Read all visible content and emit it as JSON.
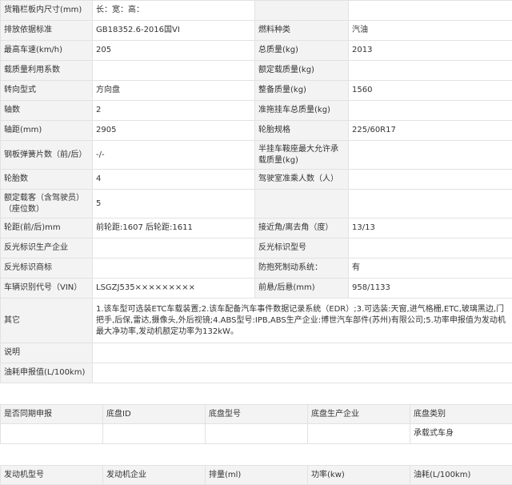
{
  "main_table": {
    "rows": [
      {
        "l1": "货箱栏板内尺寸(mm)",
        "v1": "长：宽：高：",
        "l2": "",
        "v2": ""
      },
      {
        "l1": "排放依据标准",
        "v1": "GB18352.6-2016国VI",
        "l2": "燃料种类",
        "v2": "汽油"
      },
      {
        "l1": "最高车速(km/h)",
        "v1": "205",
        "l2": "总质量(kg)",
        "v2": "2013"
      },
      {
        "l1": "载质量利用系数",
        "v1": "",
        "l2": "额定载质量(kg)",
        "v2": ""
      },
      {
        "l1": "转向型式",
        "v1": "方向盘",
        "l2": "整备质量(kg)",
        "v2": "1560"
      },
      {
        "l1": "轴数",
        "v1": "2",
        "l2": "准拖挂车总质量(kg)",
        "v2": ""
      },
      {
        "l1": "轴距(mm)",
        "v1": "2905",
        "l2": "轮胎规格",
        "v2": "225/60R17"
      },
      {
        "l1": "钢板弹簧片数（前/后）",
        "v1": "-/-",
        "l2": "半挂车鞍座最大允许承载质量(kg)",
        "v2": ""
      },
      {
        "l1": "轮胎数",
        "v1": "4",
        "l2": "驾驶室准乘人数（人）",
        "v2": ""
      },
      {
        "l1": "额定载客（含驾驶员）（座位数）",
        "v1": "5",
        "l2": "",
        "v2": ""
      },
      {
        "l1": "轮距(前/后)mm",
        "v1": "前轮距:1607 后轮距:1611",
        "l2": "接近角/离去角（度）",
        "v2": "13/13"
      },
      {
        "l1": "反光标识生产企业",
        "v1": "",
        "l2": "反光标识型号",
        "v2": ""
      },
      {
        "l1": "反光标识商标",
        "v1": "",
        "l2": "防抱死制动系统：",
        "v2": "有"
      },
      {
        "l1": "车辆识别代号（VIN）",
        "v1": "LSGZJ535×××××××××",
        "l2": "前悬/后悬(mm)",
        "v2": "958/1133"
      }
    ],
    "other_label": "其它",
    "other_value": "1.该车型可选装ETC车载装置;2.该车配备汽车事件数据记录系统（EDR）;3.可选装:天窗,进气格栅,ETC,玻璃黑边,门把手,后保,雷达,摄像头,外后视镜;4.ABS型号:IPB,ABS生产企业:博世汽车部件(苏州)有限公司;5.功率申报值为发动机最大净功率,发动机额定功率为132kW。",
    "note_label": "说明",
    "note_value": "",
    "fuel_label": "油耗申报值(L/100km)",
    "fuel_value": ""
  },
  "chassis_table": {
    "headers": [
      "是否同期申报",
      "底盘ID",
      "底盘型号",
      "底盘生产企业",
      "底盘类别"
    ],
    "row": [
      "",
      "",
      "",
      "",
      "承载式车身"
    ]
  },
  "engine_table": {
    "headers": [
      "发动机型号",
      "发动机企业",
      "排量(ml)",
      "功率(kw)",
      "油耗(L/100km)"
    ]
  }
}
